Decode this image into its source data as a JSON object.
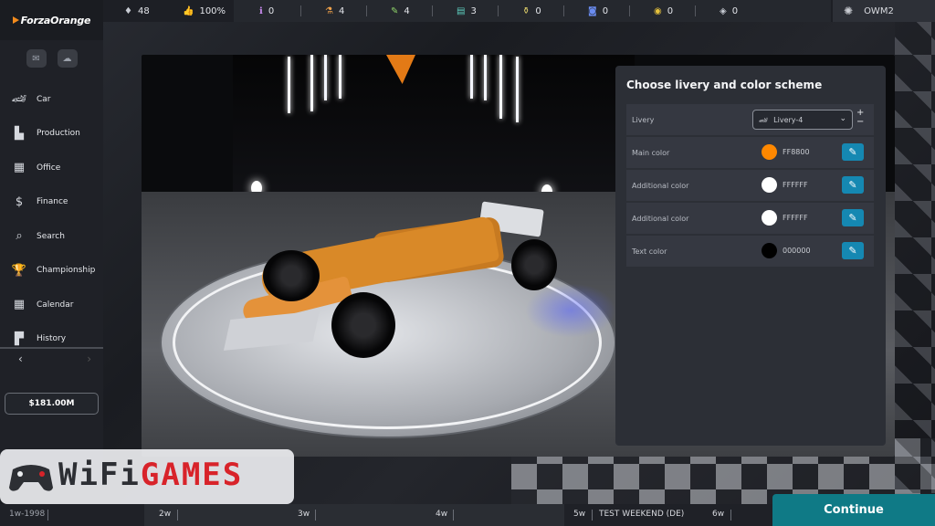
{
  "topbar": {
    "brand": "ForzaOrange",
    "stats": [
      {
        "icon": "drop-icon",
        "glyph": "♦",
        "value": "48"
      },
      {
        "icon": "thumbs-up-icon",
        "glyph": "👍",
        "value": "100%"
      },
      {
        "icon": "info-icon",
        "glyph": "ℹ",
        "value": "0"
      },
      {
        "icon": "engineer-icon",
        "glyph": "⚗",
        "value": "4"
      },
      {
        "icon": "wrench-icon",
        "glyph": "✎",
        "value": "4"
      },
      {
        "icon": "case-icon",
        "glyph": "▤",
        "value": "3"
      },
      {
        "icon": "flask-icon",
        "glyph": "⚱",
        "value": "0"
      },
      {
        "icon": "gamepad-icon",
        "glyph": "◙",
        "value": "0"
      },
      {
        "icon": "coin-icon",
        "glyph": "◉",
        "value": "0"
      },
      {
        "icon": "box-icon",
        "glyph": "◈",
        "value": "0"
      }
    ],
    "user": {
      "name": "OWM2",
      "avatar_glyph": "✺"
    }
  },
  "sidebar": {
    "mail_glyph": "✉",
    "chat_glyph": "☁",
    "items": [
      {
        "key": "car",
        "label": "Car",
        "glyph": "🏎"
      },
      {
        "key": "production",
        "label": "Production",
        "glyph": "▙"
      },
      {
        "key": "office",
        "label": "Office",
        "glyph": "▦"
      },
      {
        "key": "finance",
        "label": "Finance",
        "glyph": "$"
      },
      {
        "key": "search",
        "label": "Search",
        "glyph": "⌕"
      },
      {
        "key": "championship",
        "label": "Championship",
        "glyph": "🏆"
      },
      {
        "key": "calendar",
        "label": "Calendar",
        "glyph": "▦"
      },
      {
        "key": "history",
        "label": "History",
        "glyph": "▛"
      }
    ],
    "prev": "‹",
    "next": "›",
    "money": "$181.00M"
  },
  "panel": {
    "title": "Choose livery and color scheme",
    "livery_label": "Livery",
    "livery_value": "Livery-4",
    "colors": [
      {
        "label": "Main color",
        "hex": "FF8800",
        "swatch": "#FF8800"
      },
      {
        "label": "Additional color",
        "hex": "FFFFFF",
        "swatch": "#FFFFFF"
      },
      {
        "label": "Additional color",
        "hex": "FFFFFF",
        "swatch": "#FFFFFF"
      },
      {
        "label": "Text color",
        "hex": "000000",
        "swatch": "#000000"
      }
    ],
    "plus": "+",
    "minus": "−",
    "chevron": "⌄"
  },
  "timeline": {
    "items": [
      {
        "label": "1w-1998"
      },
      {
        "label": "2w"
      },
      {
        "label": "3w"
      },
      {
        "label": "4w"
      },
      {
        "label": "5w"
      },
      {
        "label": "TEST WEEKEND (DE)"
      },
      {
        "label": "6w"
      }
    ],
    "continue": "Continue"
  },
  "watermark": {
    "text_a": "WiFi",
    "text_b": "GAMES"
  }
}
